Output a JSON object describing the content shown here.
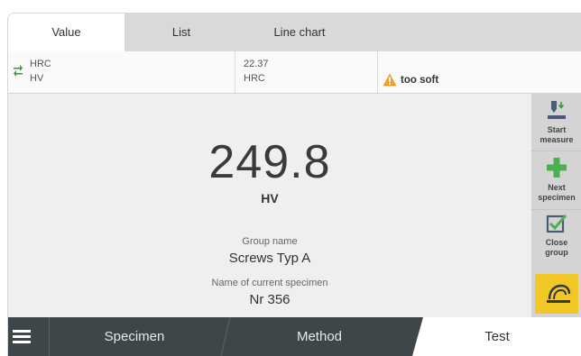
{
  "tabs": [
    {
      "label": "Value",
      "active": true
    },
    {
      "label": "List",
      "active": false
    },
    {
      "label": "Line chart",
      "active": false
    }
  ],
  "info": {
    "scale_from": "HRC",
    "scale_to": "HV",
    "converted_value": "22.37",
    "converted_unit": "HRC",
    "warning": "too soft"
  },
  "measurement": {
    "value": "249.8",
    "unit": "HV"
  },
  "group": {
    "label": "Group name",
    "value": "Screws Typ A"
  },
  "specimen": {
    "label": "Name of current specimen",
    "value": "Nr 356"
  },
  "side": {
    "start_label_1": "Start",
    "start_label_2": "measure",
    "next_label_1": "Next",
    "next_label_2": "specimen",
    "close_label_1": "Close",
    "close_label_2": "group"
  },
  "bottom": {
    "specimen": "Specimen",
    "method": "Method",
    "test": "Test"
  },
  "colors": {
    "accent_yellow": "#f2c624",
    "plus_green": "#4caf50",
    "bottom_bar": "#3e4649",
    "warning_orange": "#f0a020"
  }
}
